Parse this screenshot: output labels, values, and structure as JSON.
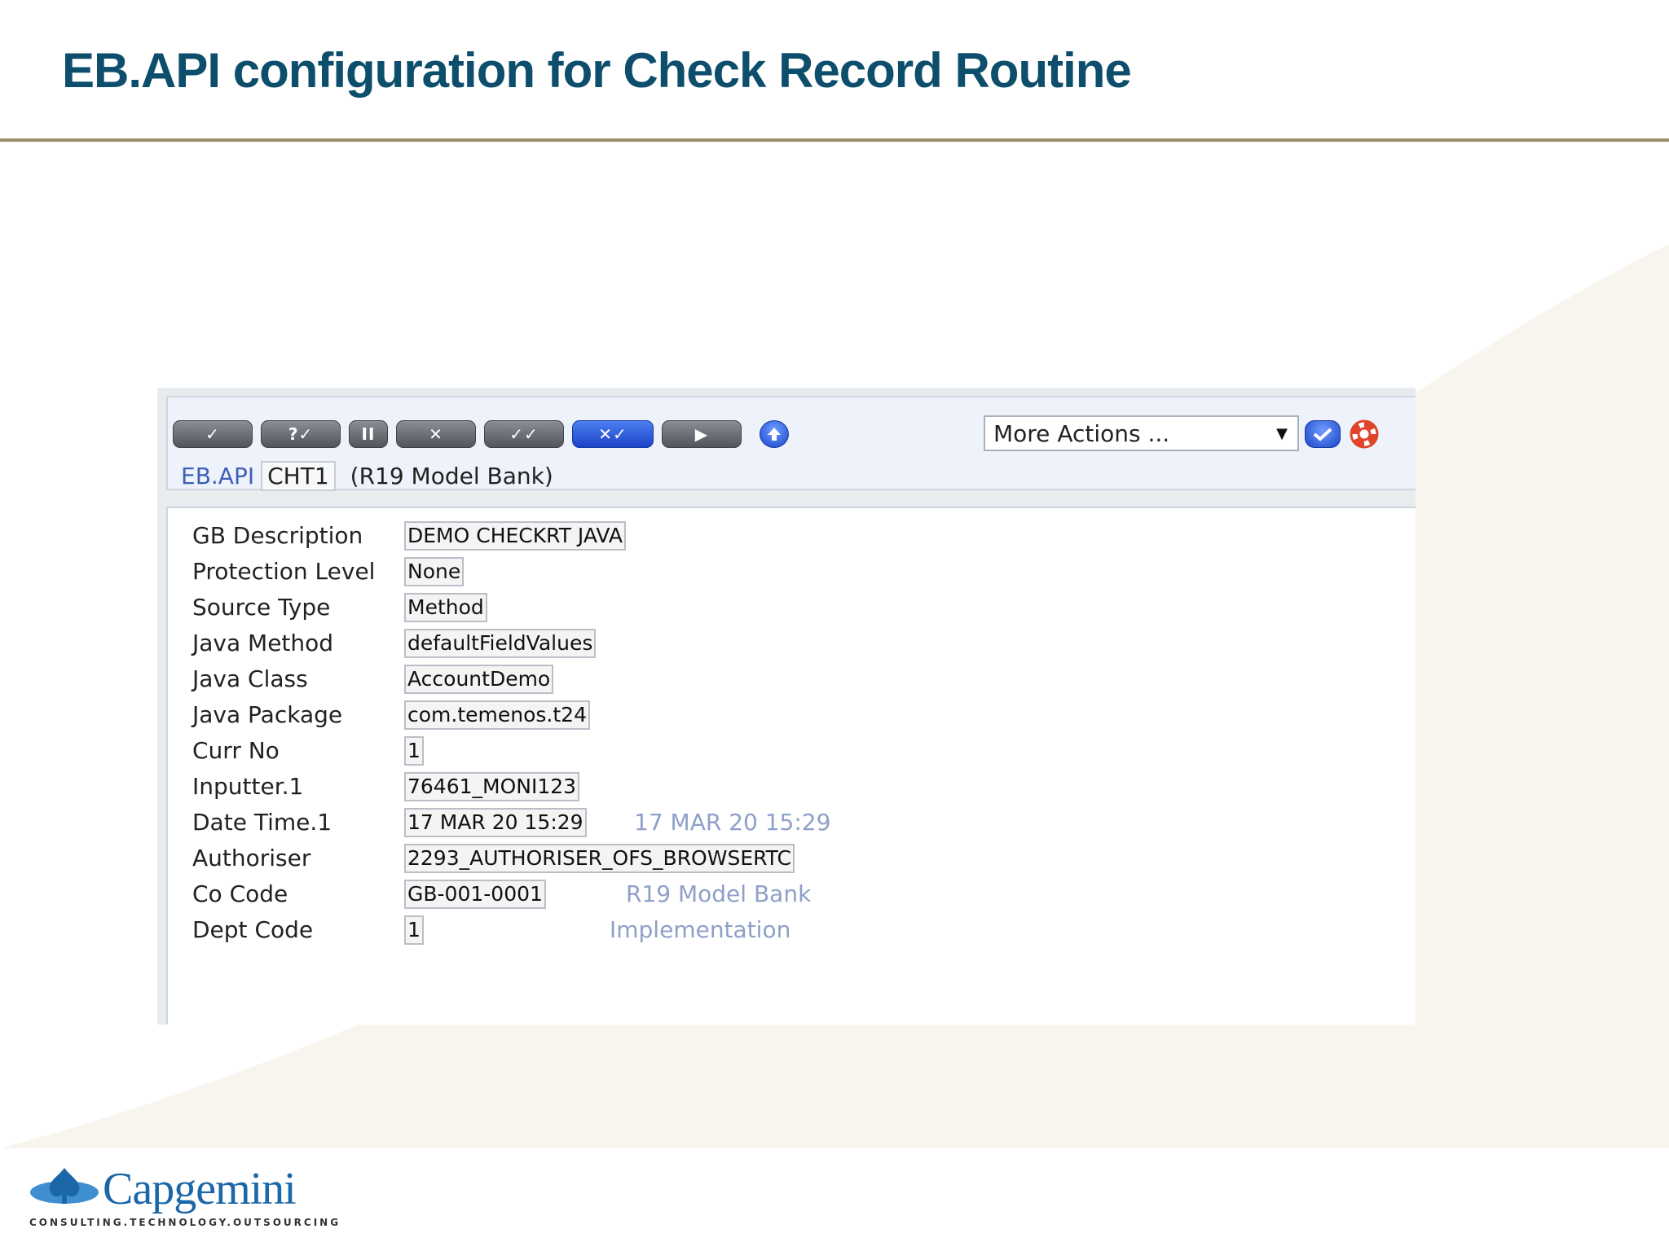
{
  "slide": {
    "title": "EB.API configuration for Check Record Routine"
  },
  "toolbar": {
    "buttons": [
      {
        "name": "commit",
        "glyph": "✓"
      },
      {
        "name": "validate",
        "glyph": "?✓"
      },
      {
        "name": "hold",
        "glyph": "II"
      },
      {
        "name": "delete",
        "glyph": "✕"
      },
      {
        "name": "authorise",
        "glyph": "✓✓"
      },
      {
        "name": "reverse",
        "glyph": "✕✓"
      },
      {
        "name": "next",
        "glyph": "▶"
      }
    ],
    "more_actions": "More Actions ...",
    "dropdown_arrow": "▼"
  },
  "record": {
    "application": "EB.API",
    "id": "CHT1",
    "company": "(R19 Model Bank)"
  },
  "fields": [
    {
      "label": "GB Description",
      "value": "DEMO CHECKRT JAVA"
    },
    {
      "label": "Protection Level",
      "value": "None"
    },
    {
      "label": "Source Type",
      "value": "Method"
    },
    {
      "label": "Java Method",
      "value": "defaultFieldValues"
    },
    {
      "label": "Java Class",
      "value": "AccountDemo"
    },
    {
      "label": "Java Package",
      "value": "com.temenos.t24"
    },
    {
      "label": "Curr No",
      "value": "1"
    },
    {
      "label": "Inputter.1",
      "value": "76461_MONI123"
    },
    {
      "label": "Date Time.1",
      "value": "17 MAR 20 15:29",
      "enrichment": "17 MAR 20 15:29"
    },
    {
      "label": "Authoriser",
      "value": "2293_AUTHORISER_OFS_BROWSERTC"
    },
    {
      "label": "Co Code",
      "value": "GB-001-0001",
      "enrichment": "R19 Model Bank"
    },
    {
      "label": "Dept Code",
      "value": "1",
      "enrichment": "Implementation"
    }
  ],
  "logo": {
    "wordmark": "Capgemini",
    "tagline": "CONSULTING.TECHNOLOGY.OUTSOURCING"
  },
  "colors": {
    "title": "#0c4e6b",
    "rule": "#9b8f68",
    "enrichment_text": "#8ea0c8",
    "blue_button": "#1b43c7"
  }
}
